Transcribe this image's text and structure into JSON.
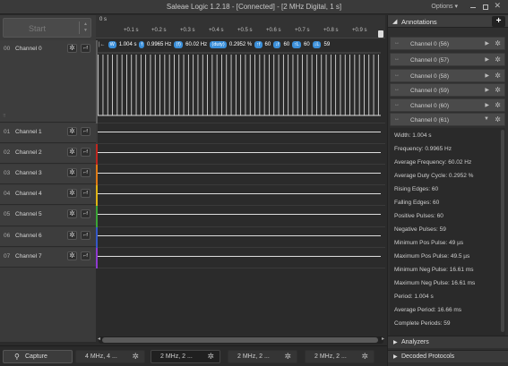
{
  "window": {
    "title": "Saleae Logic 1.2.18 - [Connected] - [2 MHz Digital, 1 s]",
    "options_label": "Options ▾",
    "minimize_glyph": "",
    "close_glyph": "✕"
  },
  "start_button": {
    "label": "Start"
  },
  "channels": [
    {
      "num": "00",
      "name": "Channel 0",
      "color": "#5c5c5c"
    },
    {
      "num": "01",
      "name": "Channel 1",
      "color": "#3a3a3a"
    },
    {
      "num": "02",
      "name": "Channel 2",
      "color": "#c0271f"
    },
    {
      "num": "03",
      "name": "Channel 3",
      "color": "#e07a15"
    },
    {
      "num": "04",
      "name": "Channel 4",
      "color": "#e0b415"
    },
    {
      "num": "05",
      "name": "Channel 5",
      "color": "#3aa536"
    },
    {
      "num": "06",
      "name": "Channel 6",
      "color": "#3559c9"
    },
    {
      "num": "07",
      "name": "Channel 7",
      "color": "#8e3ad0"
    }
  ],
  "channel_button_glyphs": {
    "gear": "✲",
    "trigger": "⌐f"
  },
  "ruler": {
    "start": "0 s",
    "ticks": [
      "+0.1 s",
      "+0.2 s",
      "+0.3 s",
      "+0.4 s",
      "+0.5 s",
      "+0.6 s",
      "+0.7 s",
      "+0.8 s",
      "+0.9 s"
    ]
  },
  "measurements": {
    "width_tag": "W",
    "width": "1.004 s",
    "freq_tag": "f",
    "freq": "0.9965 Hz",
    "avg_freq_tag": "⟨f⟩",
    "avg_freq": "60.02 Hz",
    "duty_tag": "⟨duty⟩",
    "duty": "0.2952 %",
    "rise_tag": "↑f",
    "rise": "60",
    "fall_tag": "↓f",
    "fall": "60",
    "pos_tag": "↑L",
    "pos": "60",
    "neg_tag": "↓L",
    "neg": "59"
  },
  "annotations": {
    "header": "Annotations",
    "add_label": "+",
    "items": [
      {
        "label": "Channel 0 (56)"
      },
      {
        "label": "Channel 0 (57)"
      },
      {
        "label": "Channel 0 (58)"
      },
      {
        "label": "Channel 0 (59)"
      },
      {
        "label": "Channel 0 (60)"
      },
      {
        "label": "Channel 0 (61)"
      }
    ],
    "details": [
      "Width: 1.004 s",
      "Frequency: 0.9965 Hz",
      "Average Frequency: 60.02 Hz",
      "Average Duty Cycle: 0.2952 %",
      "Rising Edges: 60",
      "Falling Edges: 60",
      "Positive Pulses: 60",
      "Negative Pulses: 59",
      "Minimum Pos Pulse: 49 µs",
      "Maximum Pos Pulse: 49.5 µs",
      "Minimum Neg Pulse: 16.61 ms",
      "Maximum Neg Pulse: 16.61 ms",
      "Period: 1.004 s",
      "Average Period: 16.66 ms",
      "Complete Periods: 59"
    ]
  },
  "analyzers": {
    "label": "Analyzers"
  },
  "decoded_protocols": {
    "label": "Decoded Protocols"
  },
  "bottom": {
    "capture_label": "Capture",
    "tabs": [
      {
        "label": "4 MHz, 4 ...",
        "active": false
      },
      {
        "label": "2 MHz, 2 ...",
        "active": true
      },
      {
        "label": "2 MHz, 2 ...",
        "active": false
      },
      {
        "label": "2 MHz, 2 ...",
        "active": false
      }
    ]
  }
}
